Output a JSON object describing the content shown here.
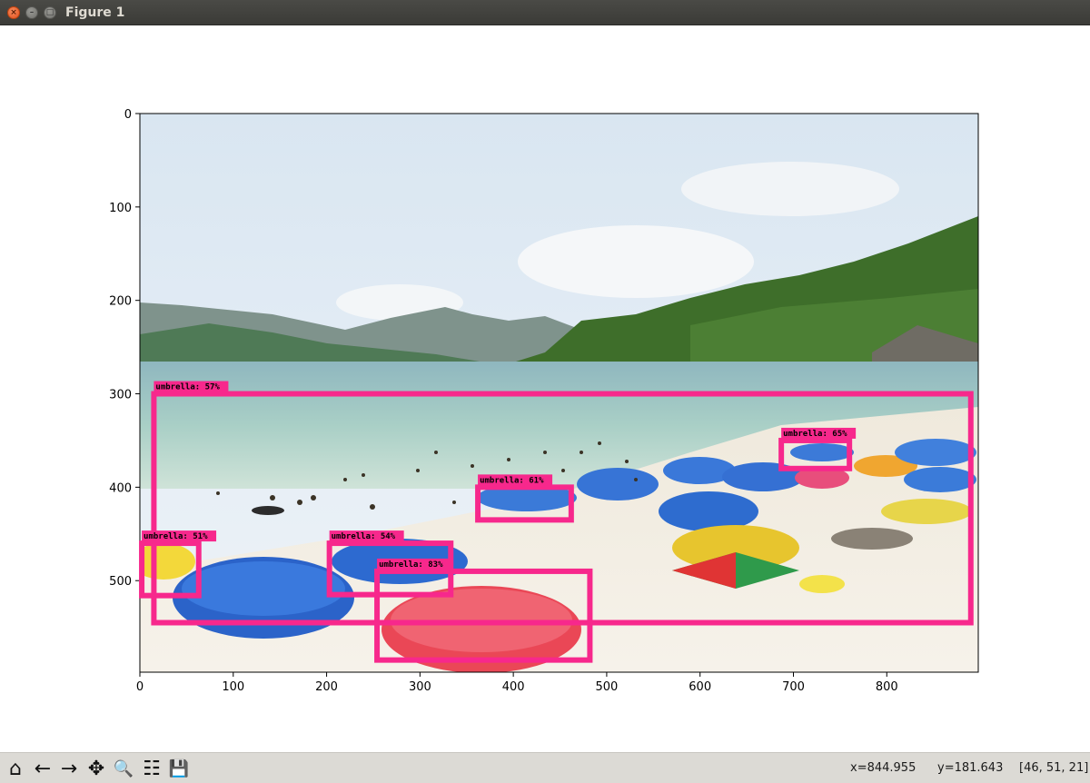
{
  "window": {
    "title": "Figure 1",
    "close_glyph": "×",
    "min_glyph": "–",
    "max_glyph": "□"
  },
  "plot": {
    "x_ticks": [
      "0",
      "100",
      "200",
      "300",
      "400",
      "500",
      "600",
      "700",
      "800"
    ],
    "y_ticks": [
      "0",
      "100",
      "200",
      "300",
      "400",
      "500"
    ],
    "image_extent": {
      "x": [
        0,
        898
      ],
      "y": [
        0,
        598
      ]
    },
    "detections": [
      {
        "label": "umbrella: 57%",
        "x0": 15,
        "y0": 300,
        "x1": 890,
        "y1": 545
      },
      {
        "label": "umbrella: 65%",
        "x0": 687,
        "y0": 350,
        "x1": 760,
        "y1": 380
      },
      {
        "label": "umbrella: 61%",
        "x0": 362,
        "y0": 400,
        "x1": 462,
        "y1": 435
      },
      {
        "label": "umbrella: 51%",
        "x0": 2,
        "y0": 460,
        "x1": 63,
        "y1": 516
      },
      {
        "label": "umbrella: 54%",
        "x0": 203,
        "y0": 460,
        "x1": 333,
        "y1": 515
      },
      {
        "label": "umbrella: 83%",
        "x0": 254,
        "y0": 490,
        "x1": 482,
        "y1": 585
      }
    ],
    "box_color": "#f7288c",
    "label_bg": "#f7288c"
  },
  "toolbar": {
    "home": "⌂",
    "back": "←",
    "forward": "→",
    "pan": "✥",
    "zoom": "🔍",
    "configure": "☷",
    "save": "💾"
  },
  "status": {
    "x": "x=844.955",
    "y": "y=181.643",
    "rgb": "[46, 51, 21]"
  }
}
